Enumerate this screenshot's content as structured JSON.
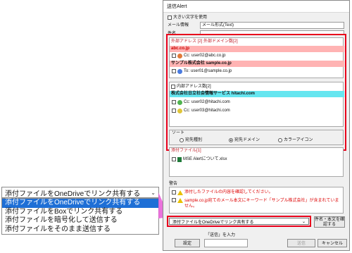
{
  "window": {
    "title": "送信Alert",
    "large_text_label": "大きい文字を使用",
    "mail_info_label": "メール情報",
    "mail_info_value": "メール形式(Text)",
    "subject_label": "件名"
  },
  "external": {
    "header": "外部アドレス [2] 外部ドメイン数[2]",
    "groups": [
      {
        "domain": "abc.co.jp",
        "rows": [
          {
            "prefix": "Cc:",
            "addr": "user02@abc.co.jp"
          }
        ]
      },
      {
        "domain": "サンプル株式会社  sample.co.jp",
        "rows": [
          {
            "prefix": "To:",
            "addr": "user01@sample.co.jp"
          }
        ]
      }
    ]
  },
  "internal": {
    "header": "内部アドレス数[2]",
    "domain": "株式会社日立社会情報サービス  hitachi.com",
    "rows": [
      {
        "prefix": "Cc:",
        "addr": "user02@hitachi.com"
      },
      {
        "prefix": "Cc:",
        "addr": "user03@hitachi.com"
      }
    ]
  },
  "sort": {
    "label": "ソート",
    "options": [
      "宛先種別",
      "宛先ドメイン",
      "カラーアイコン"
    ],
    "selected_index": 1
  },
  "attachments": {
    "header": "添付ファイル[1]",
    "file": "MSE Alertについて.xlsx"
  },
  "warning": {
    "label": "警告",
    "lines": [
      "添付したファイルの内容を確認してください。",
      "sample.co.jp宛てのメール本文にキーワード「サンプル株式会社」が含まれていません。"
    ]
  },
  "share_dropdown": {
    "value": "添付ファイルをOneDriveでリンク共有する",
    "options": [
      "添付ファイルをOneDriveでリンク共有する",
      "添付ファイルをBoxでリンク共有する",
      "添付ファイルを暗号化して送信する",
      "添付ファイルをそのまま送信する"
    ],
    "selected_index": 0
  },
  "buttons": {
    "check_subject": "件名・本文を確認する",
    "settings": "設定",
    "send_prompt": "「送信」を入力",
    "send": "送信",
    "cancel": "キャンセル"
  },
  "colors": {
    "highlight": "#e8001c",
    "external_header": "#ffb3b3",
    "internal_header": "#66e6f0",
    "selection": "#1e6fd6"
  }
}
